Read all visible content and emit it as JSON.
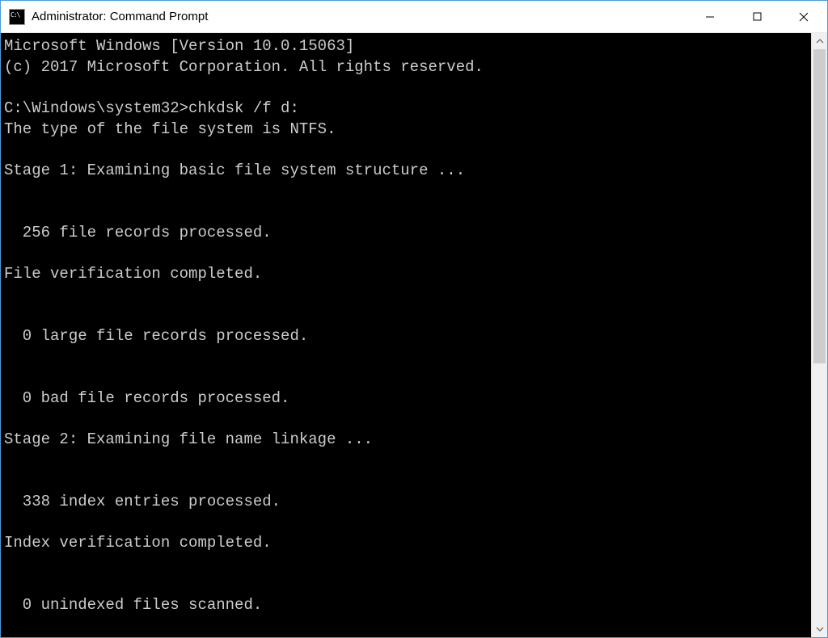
{
  "window": {
    "title": "Administrator: Command Prompt"
  },
  "terminal": {
    "lines": [
      "Microsoft Windows [Version 10.0.15063]",
      "(c) 2017 Microsoft Corporation. All rights reserved.",
      "",
      "C:\\Windows\\system32>chkdsk /f d:",
      "The type of the file system is NTFS.",
      "",
      "Stage 1: Examining basic file system structure ...",
      "",
      "",
      "  256 file records processed.",
      "",
      "File verification completed.",
      "",
      "",
      "  0 large file records processed.",
      "",
      "",
      "  0 bad file records processed.",
      "",
      "Stage 2: Examining file name linkage ...",
      "",
      "",
      "  338 index entries processed.",
      "",
      "Index verification completed.",
      "",
      "",
      "  0 unindexed files scanned."
    ]
  }
}
